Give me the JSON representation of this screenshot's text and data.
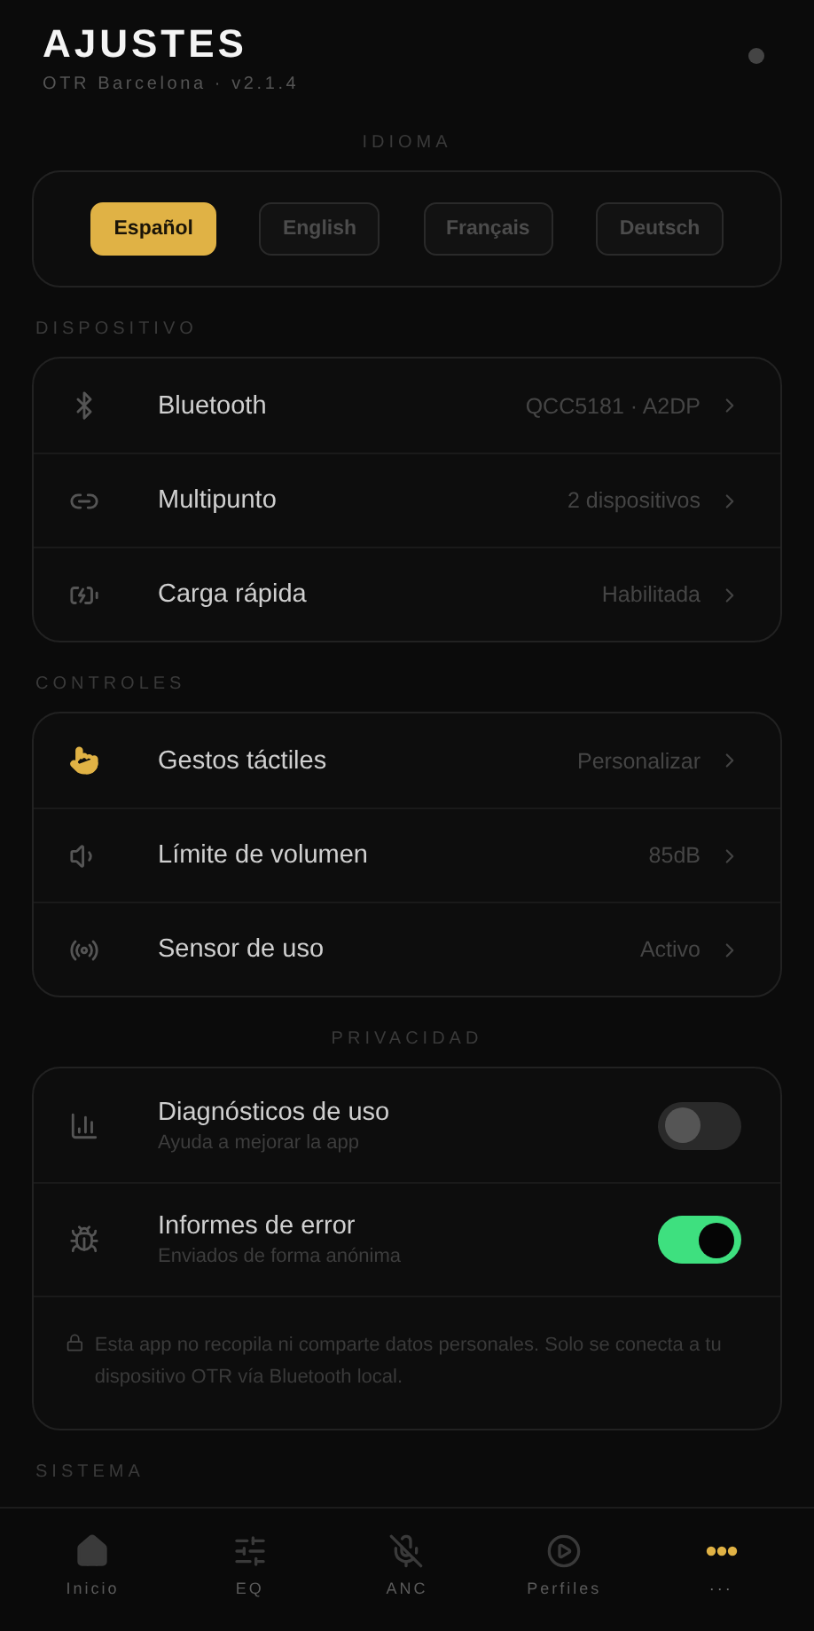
{
  "header": {
    "title": "AJUSTES",
    "subtitle": "OTR Barcelona · v2.1.4"
  },
  "language": {
    "heading": "IDIOMA",
    "centered": true,
    "options": [
      {
        "label": "Español",
        "selected": true
      },
      {
        "label": "English",
        "selected": false
      },
      {
        "label": "Français",
        "selected": false
      },
      {
        "label": "Deutsch",
        "selected": false
      }
    ]
  },
  "sections": [
    {
      "heading": "DISPOSITIVO",
      "centered": false,
      "rows": [
        {
          "kind": "link",
          "label": "Bluetooth",
          "value": "QCC5181 · A2DP"
        },
        {
          "kind": "link",
          "label": "Multipunto",
          "value": "2 dispositivos"
        },
        {
          "kind": "link",
          "label": "Carga rápida",
          "value": "Habilitada"
        }
      ]
    },
    {
      "heading": "CONTROLES",
      "centered": false,
      "rows": [
        {
          "kind": "link",
          "label": "Gestos táctiles",
          "value": "Personalizar"
        },
        {
          "kind": "link",
          "label": "Límite de volumen",
          "value": "85dB"
        },
        {
          "kind": "link",
          "label": "Sensor de uso",
          "value": "Activo"
        }
      ]
    },
    {
      "heading": "PRIVACIDAD",
      "centered": true,
      "rows": [
        {
          "kind": "toggle",
          "label": "Diagnósticos de uso",
          "sublabel": "Ayuda a mejorar la app",
          "on": false
        },
        {
          "kind": "toggle",
          "label": "Informes de error",
          "sublabel": "Enviados de forma anónima",
          "on": true
        },
        {
          "kind": "note",
          "text": "Esta app no recopila ni comparte datos personales. Solo se conecta a tu dispositivo OTR vía Bluetooth local."
        }
      ]
    },
    {
      "heading": "SISTEMA",
      "centered": false
    }
  ],
  "nav": [
    {
      "label": "Inicio",
      "selected": false
    },
    {
      "label": "EQ",
      "selected": false
    },
    {
      "label": "ANC",
      "selected": false
    },
    {
      "label": "Perfiles",
      "selected": false
    },
    {
      "label": "···",
      "selected": true
    }
  ]
}
